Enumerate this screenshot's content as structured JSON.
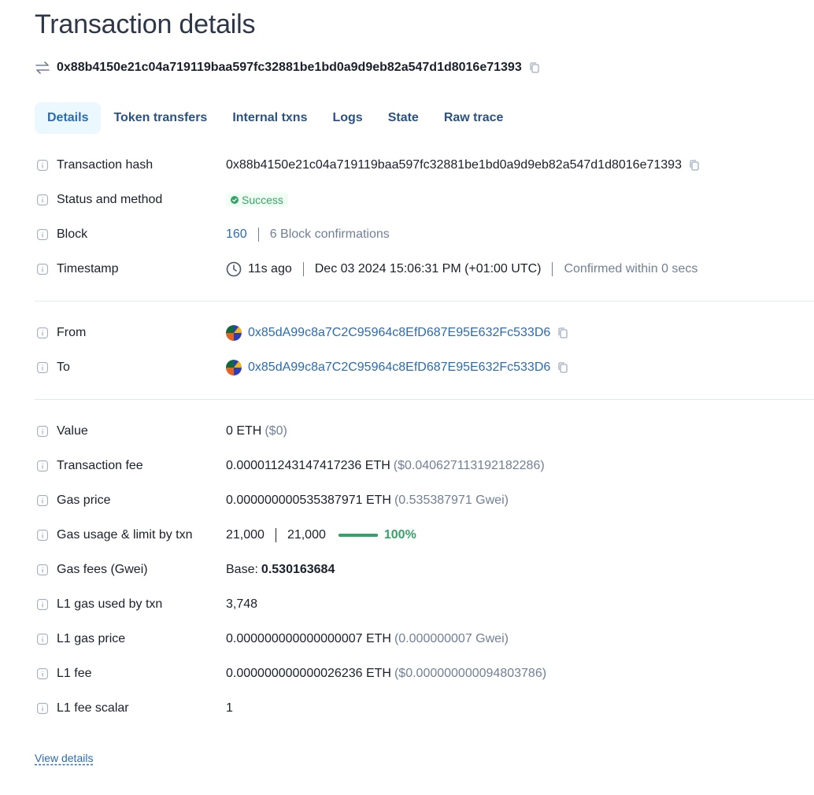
{
  "page": {
    "title": "Transaction details",
    "tx_hash": "0x88b4150e21c04a719119baa597fc32881be1bd0a9d9eb82a547d1d8016e71393"
  },
  "tabs": [
    "Details",
    "Token transfers",
    "Internal txns",
    "Logs",
    "State",
    "Raw trace"
  ],
  "details": {
    "transaction_hash": {
      "label": "Transaction hash",
      "value": "0x88b4150e21c04a719119baa597fc32881be1bd0a9d9eb82a547d1d8016e71393"
    },
    "status": {
      "label": "Status and method",
      "value": "Success"
    },
    "block": {
      "label": "Block",
      "number": "160",
      "confirmations": "6 Block confirmations"
    },
    "timestamp": {
      "label": "Timestamp",
      "ago": "11s ago",
      "datetime": "Dec 03 2024 15:06:31 PM (+01:00 UTC)",
      "confirmed": "Confirmed within 0 secs"
    },
    "from": {
      "label": "From",
      "address": "0x85dA99c8a7C2C95964c8EfD687E95E632Fc533D6"
    },
    "to": {
      "label": "To",
      "address": "0x85dA99c8a7C2C95964c8EfD687E95E632Fc533D6"
    },
    "value": {
      "label": "Value",
      "amount": "0 ETH",
      "usd": "($0)"
    },
    "tx_fee": {
      "label": "Transaction fee",
      "amount": "0.000011243147417236 ETH",
      "usd": "($0.040627113192182286)"
    },
    "gas_price": {
      "label": "Gas price",
      "amount": "0.000000000535387971 ETH",
      "gwei": "(0.535387971 Gwei)"
    },
    "gas_usage": {
      "label": "Gas usage & limit by txn",
      "used": "21,000",
      "limit": "21,000",
      "percent_text": "100%",
      "percent": 100
    },
    "gas_fees": {
      "label": "Gas fees (Gwei)",
      "base_label": "Base:",
      "base_value": "0.530163684"
    },
    "l1_gas_used": {
      "label": "L1 gas used by txn",
      "value": "3,748"
    },
    "l1_gas_price": {
      "label": "L1 gas price",
      "amount": "0.000000000000000007 ETH",
      "gwei": "(0.000000007 Gwei)"
    },
    "l1_fee": {
      "label": "L1 fee",
      "amount": "0.000000000000026236 ETH",
      "usd": "($0.000000000094803786)"
    },
    "l1_fee_scalar": {
      "label": "L1 fee scalar",
      "value": "1"
    }
  },
  "footer": {
    "view_details": "View details"
  },
  "colors": {
    "accent": "#2b6cb0",
    "success": "#38a169",
    "muted": "#718096",
    "tab_active_bg": "#ebf8ff"
  }
}
